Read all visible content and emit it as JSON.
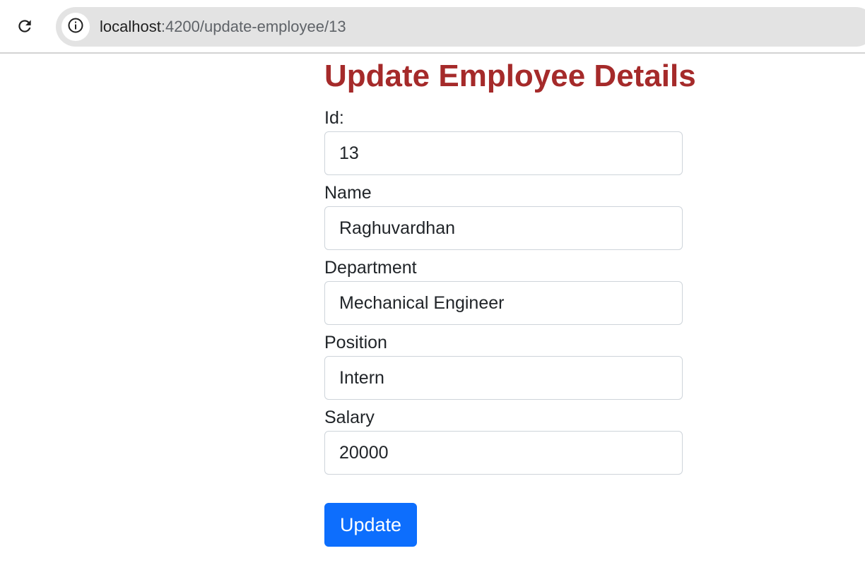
{
  "browser": {
    "url_host": "localhost",
    "url_path": ":4200/update-employee/13",
    "reload_icon": "reload-icon",
    "info_icon": "info-icon"
  },
  "page": {
    "title": "Update Employee Details"
  },
  "form": {
    "fields": [
      {
        "label": "Id:",
        "value": "13"
      },
      {
        "label": "Name",
        "value": "Raghuvardhan"
      },
      {
        "label": "Department",
        "value": "Mechanical Engineer"
      },
      {
        "label": "Position",
        "value": "Intern"
      },
      {
        "label": "Salary",
        "value": "20000"
      }
    ],
    "submit_label": "Update"
  },
  "colors": {
    "title": "#a52a2a",
    "button": "#0d6efd"
  }
}
